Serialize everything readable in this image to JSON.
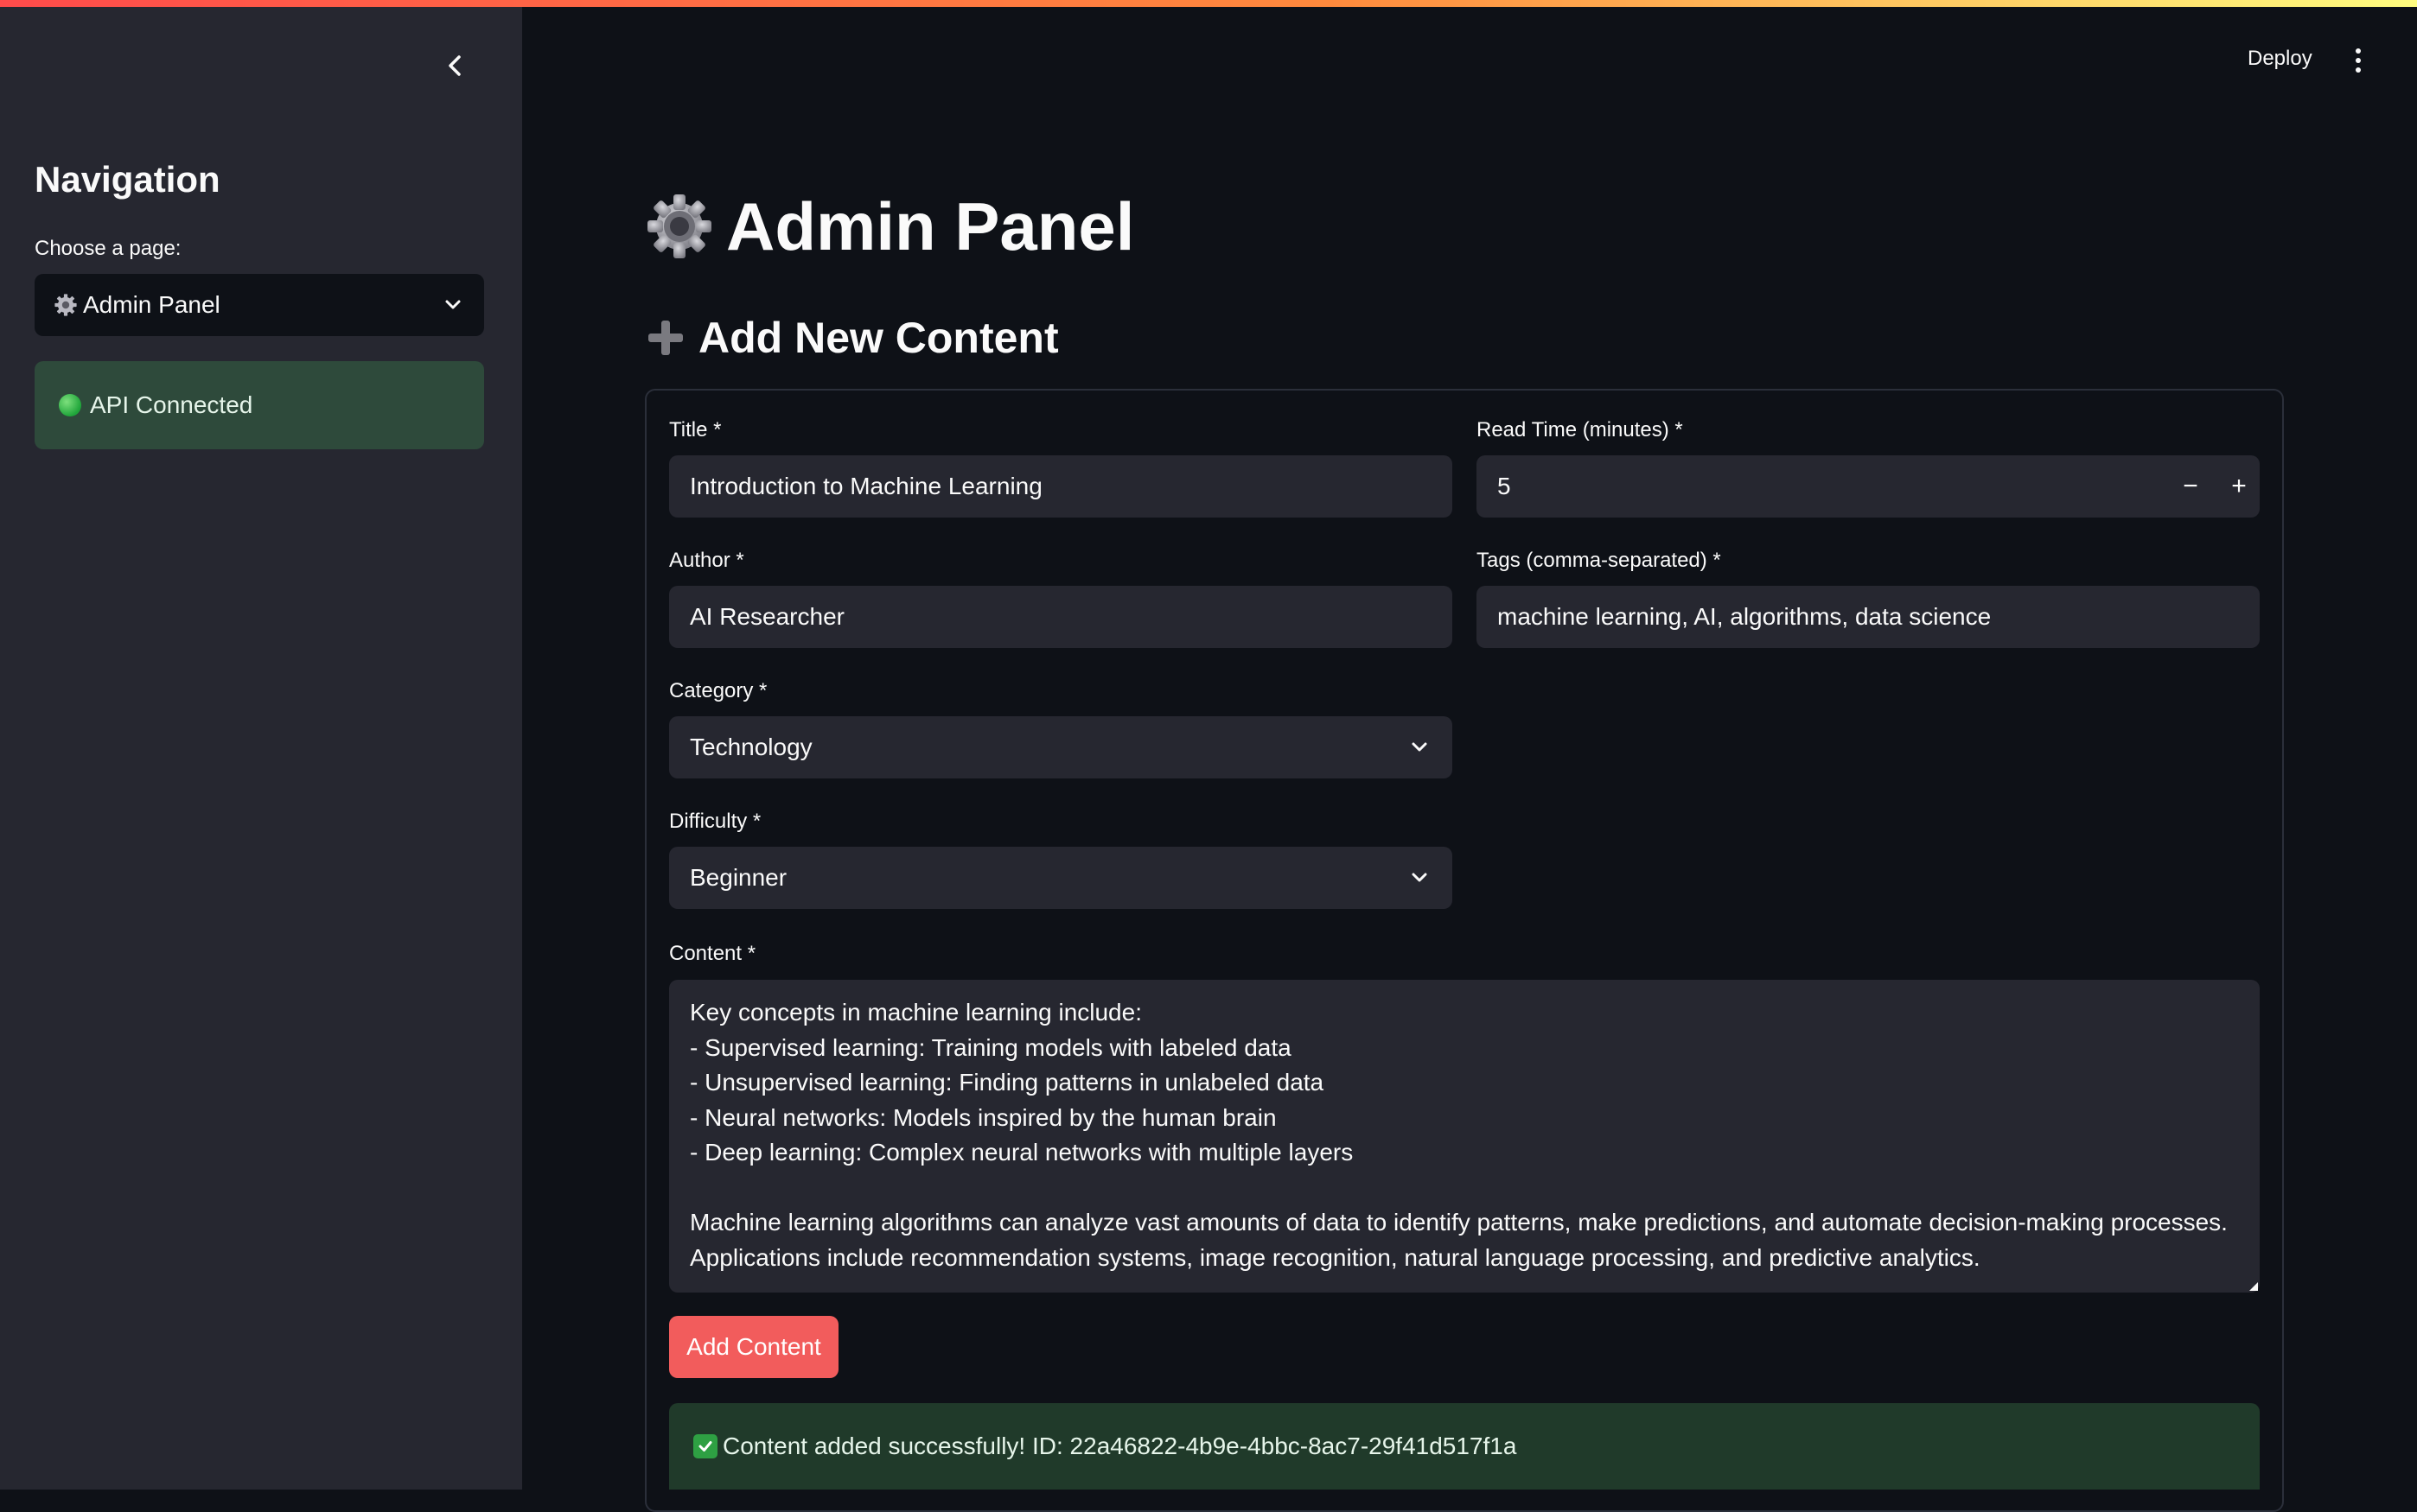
{
  "sidebar": {
    "nav_title": "Navigation",
    "choose_label": "Choose a page:",
    "selected_page": "Admin Panel",
    "api_status": "API Connected"
  },
  "header": {
    "deploy_label": "Deploy"
  },
  "main": {
    "page_title": "Admin Panel",
    "section_title": "Add New Content",
    "fields": {
      "title": {
        "label": "Title *",
        "value": "Introduction to Machine Learning"
      },
      "read_time": {
        "label": "Read Time (minutes) *",
        "value": "5",
        "minus": "−",
        "plus": "+"
      },
      "author": {
        "label": "Author *",
        "value": "AI Researcher"
      },
      "tags": {
        "label": "Tags (comma-separated) *",
        "value": "machine learning, AI, algorithms, data science"
      },
      "category": {
        "label": "Category *",
        "value": "Technology"
      },
      "difficulty": {
        "label": "Difficulty *",
        "value": "Beginner"
      },
      "content": {
        "label": "Content *",
        "value": "Key concepts in machine learning include:\n- Supervised learning: Training models with labeled data\n- Unsupervised learning: Finding patterns in unlabeled data\n- Neural networks: Models inspired by the human brain\n- Deep learning: Complex neural networks with multiple layers\n\nMachine learning algorithms can analyze vast amounts of data to identify patterns, make predictions, and automate decision-making processes.\nApplications include recommendation systems, image recognition, natural language processing, and predictive analytics."
      }
    },
    "add_button": "Add Content",
    "success_message": "Content added successfully! ID: 22a46822-4b9e-4bbc-8ac7-29f41d517f1a"
  },
  "colors": {
    "background": "#0e1117",
    "sidebar": "#262730",
    "input": "#262730",
    "primary_button": "#f25c5c",
    "success_bg": "#203a2a",
    "status_bg": "#2e4a3b"
  },
  "icons": [
    "chevron-left-icon",
    "chevron-down-icon",
    "gear-icon",
    "plus-icon",
    "green-circle-icon",
    "check-icon",
    "kebab-menu-icon"
  ]
}
